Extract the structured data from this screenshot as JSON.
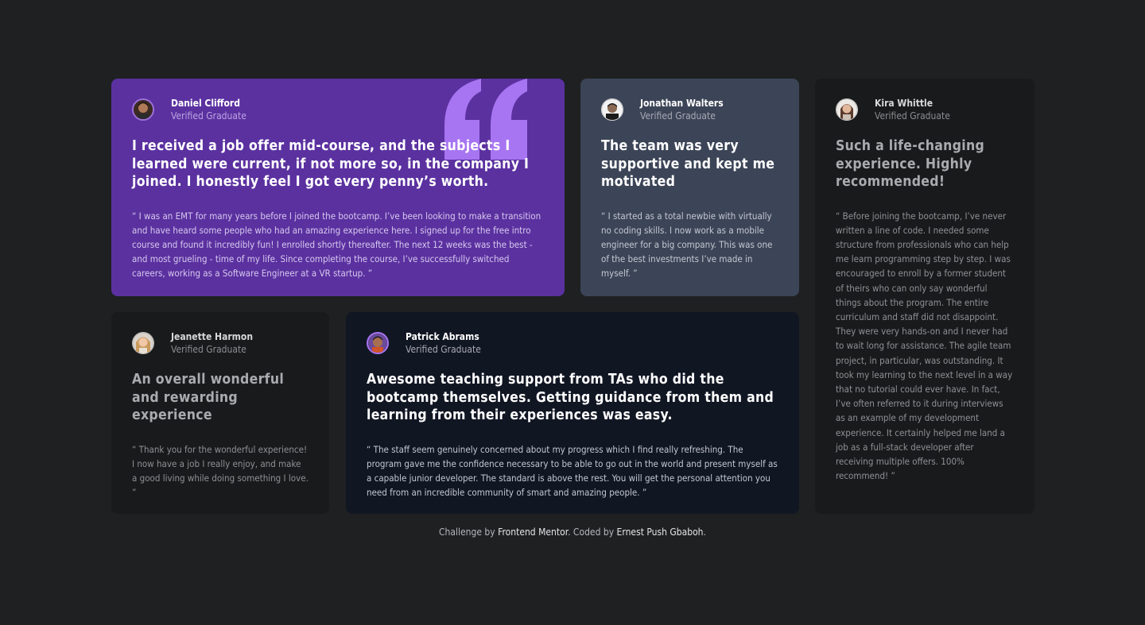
{
  "colors": {
    "page_background": "#1e2022",
    "card_daniel": "#5b31a0",
    "card_jonathan": "#3c4557",
    "card_kira": "#191a1b",
    "card_jeanette": "#191a1b",
    "card_patrick": "#111623",
    "quote_mark": "#a775f1"
  },
  "testimonials": [
    {
      "name": "Daniel Clifford",
      "role": "Verified Graduate",
      "avatar_icon": "avatar-daniel",
      "headline": "I received a job offer mid-course, and the subjects I learned were current, if not more so, in the company I joined. I honestly feel I got every penny’s worth.",
      "body": "“ I was an EMT for many years before I joined the bootcamp. I’ve been looking to make a transition and have heard some people who had an amazing experience here. I signed up for the free intro course and found it incredibly fun! I enrolled shortly thereafter. The next 12 weeks was the best - and most grueling - time of my life. Since completing the course, I’ve successfully switched careers, working as a Software Engineer at a VR startup. ”"
    },
    {
      "name": "Jonathan Walters",
      "role": "Verified Graduate",
      "avatar_icon": "avatar-jonathan",
      "headline": "The team was very supportive and kept me motivated",
      "body": "“ I started as a total newbie with virtually no coding skills. I now work as a mobile engineer for a big company. This was one of the best investments I’ve made in myself. ”"
    },
    {
      "name": "Kira Whittle",
      "role": "Verified Graduate",
      "avatar_icon": "avatar-kira",
      "headline": "Such a life-changing experience. Highly recommended!",
      "body": "“ Before joining the bootcamp, I’ve never written a line of code. I needed some structure from professionals who can help me learn programming step by step. I was encouraged to enroll by a former student of theirs who can only say wonderful things about the program. The entire curriculum and staff did not disappoint. They were very hands-on and I never had to wait long for assistance. The agile team project, in particular, was outstanding. It took my learning to the next level in a way that no tutorial could ever have. In fact, I’ve often referred to it during interviews as an example of my development experience. It certainly helped me land a job as a full-stack developer after receiving multiple offers. 100% recommend! ”"
    },
    {
      "name": "Jeanette Harmon",
      "role": "Verified Graduate",
      "avatar_icon": "avatar-jeanette",
      "headline": "An overall wonderful and rewarding experience",
      "body": "“ Thank you for the wonderful experience! I now have a job I really enjoy, and make a good living while doing something I love. ”"
    },
    {
      "name": "Patrick Abrams",
      "role": "Verified Graduate",
      "avatar_icon": "avatar-patrick",
      "headline": "Awesome teaching support from TAs who did the bootcamp themselves. Getting guidance from them and learning from their experiences was easy.",
      "body": "“ The staff seem genuinely concerned about my progress which I find really refreshing. The program gave me the confidence necessary to be able to go out in the world and present myself as a capable junior developer. The standard is above the rest. You will get the personal attention you need from an incredible community of smart and amazing people. ”"
    }
  ],
  "footer": {
    "prefix": "Challenge by",
    "link1": "Frontend Mentor",
    "middle": ". Coded by",
    "link2": "Ernest Push Gbaboh",
    "suffix": "."
  }
}
